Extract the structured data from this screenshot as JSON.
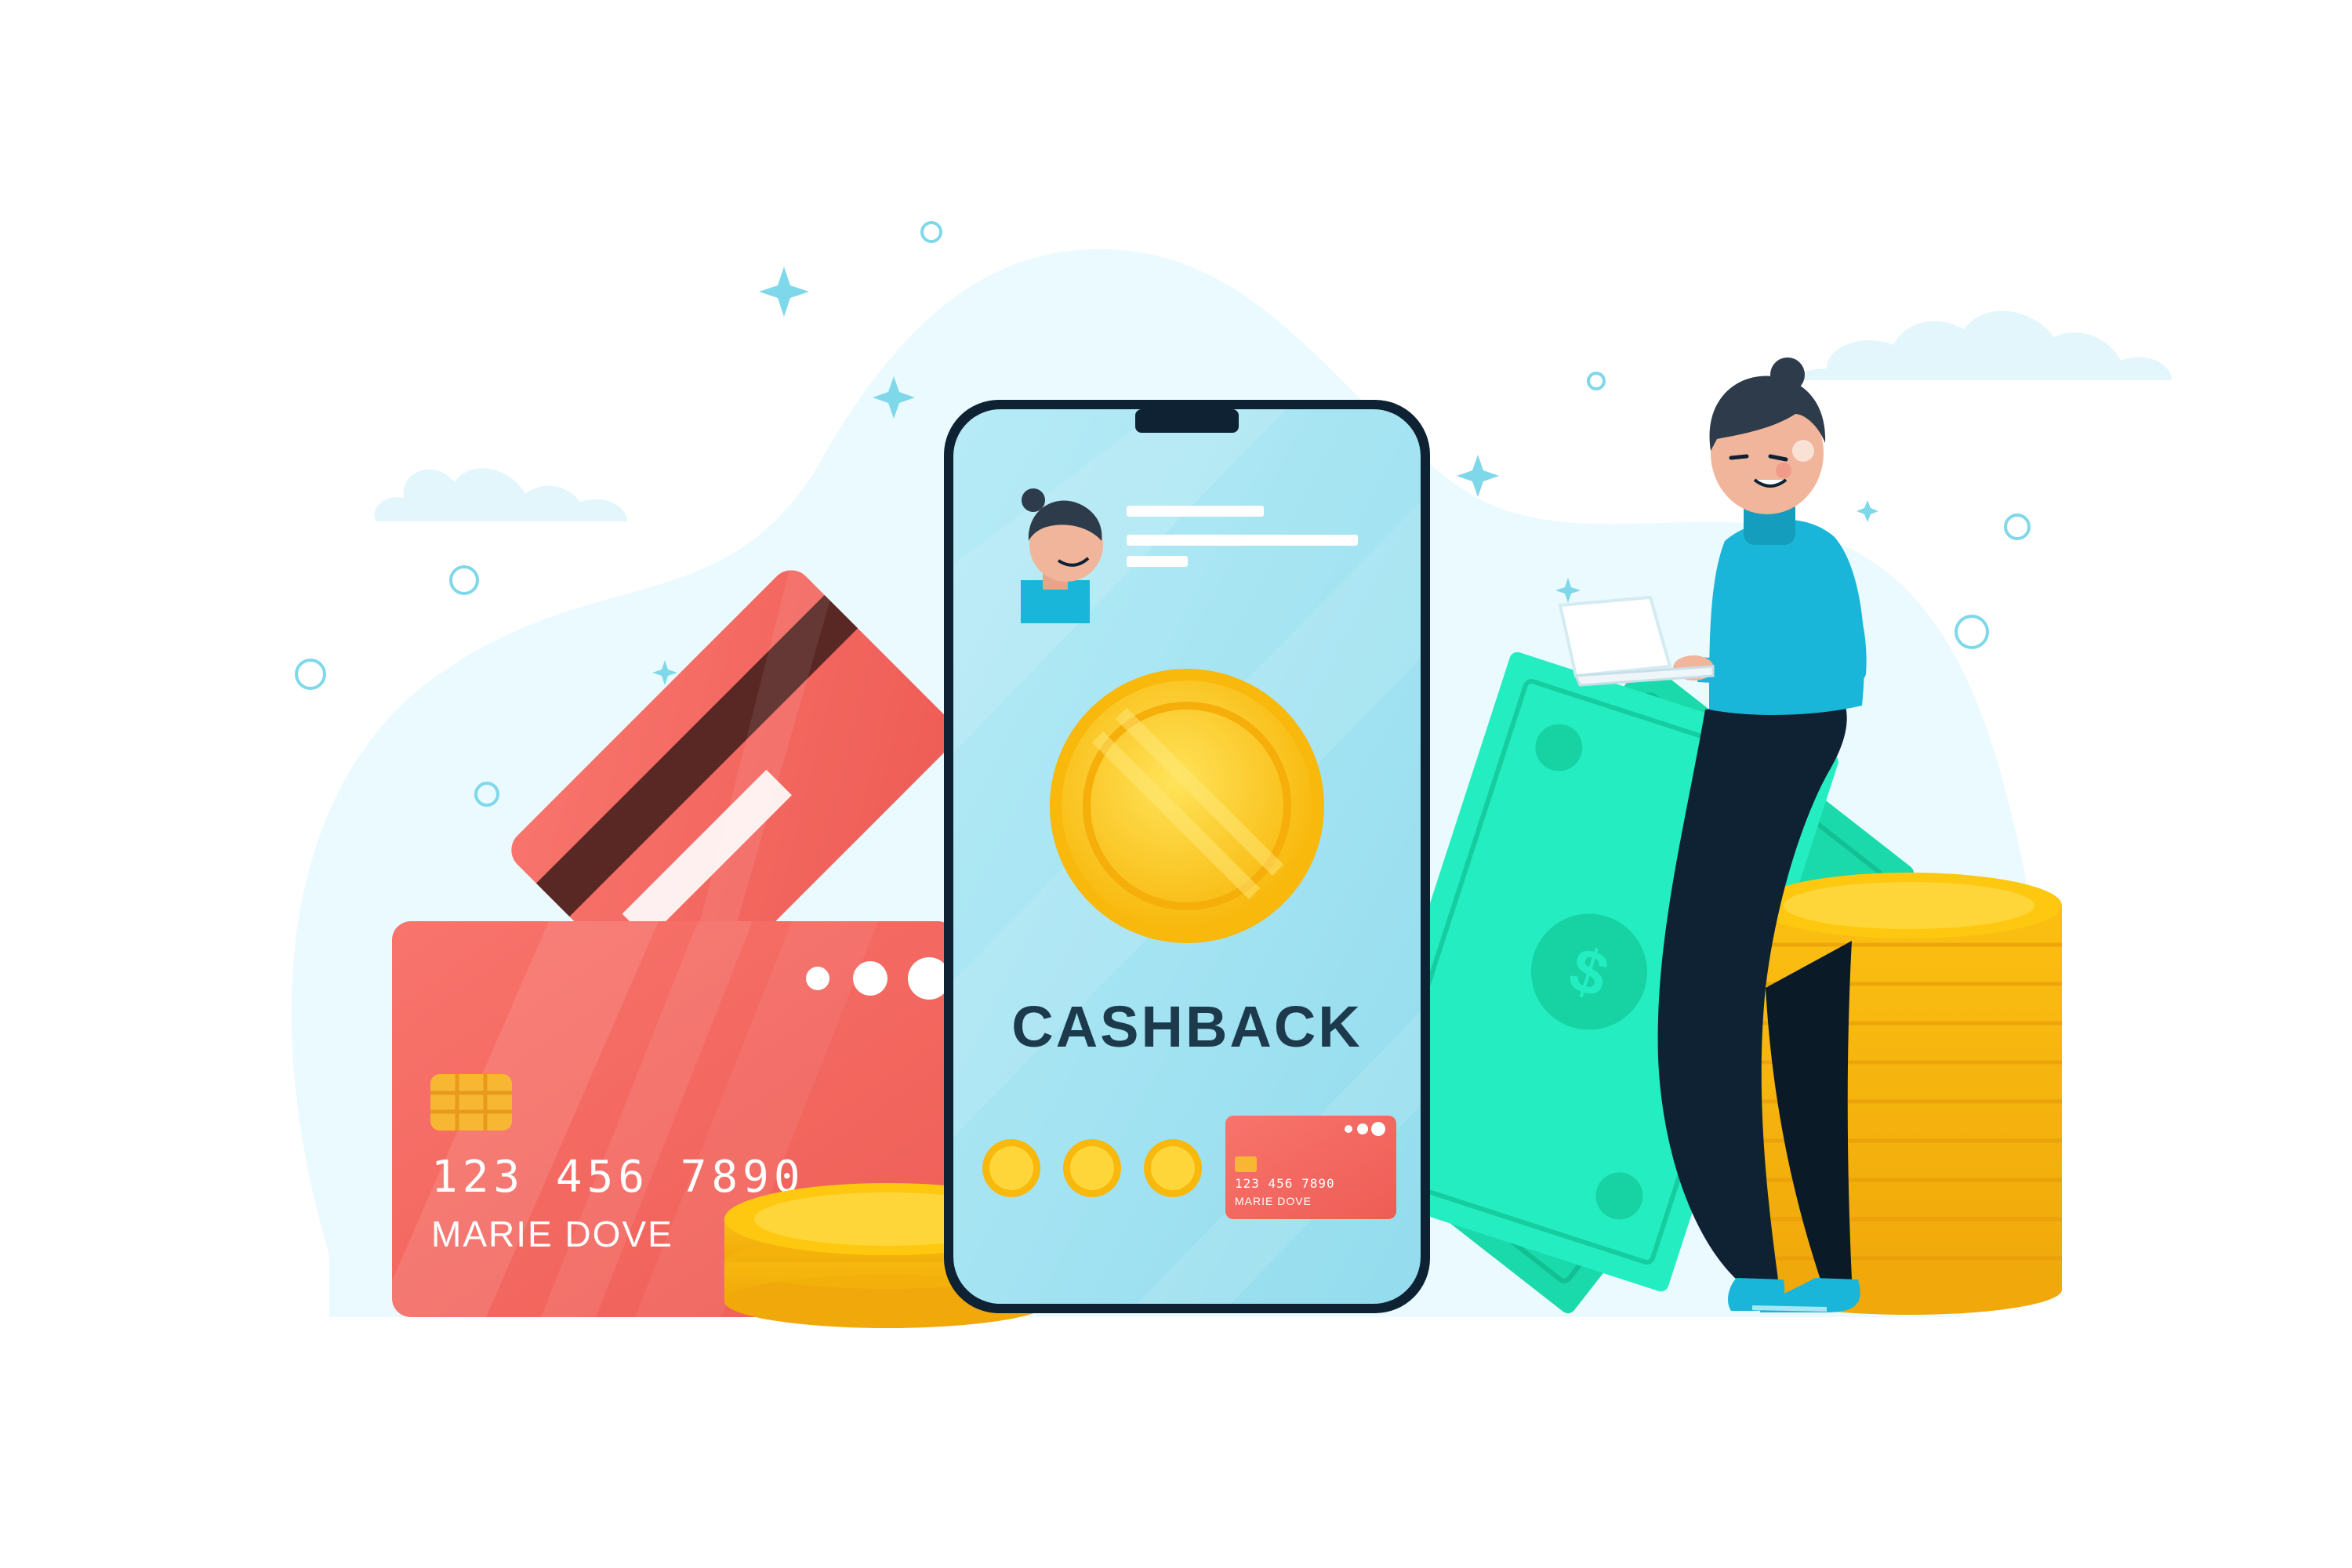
{
  "phone": {
    "headline": "CASHBACK",
    "mini_card": {
      "number": "123 456 7890",
      "holder": "MARIE DOVE"
    }
  },
  "main_card": {
    "number": "123 456 7890",
    "holder": "MARIE DOVE"
  },
  "colors": {
    "card_red": "#f2665f",
    "coin_gold": "#fdc80f",
    "phone_screen": "#a5e3f1",
    "banknote_green": "#1ee7b8",
    "outline_dark": "#0f2233",
    "sweater_blue": "#1ab6d9"
  }
}
